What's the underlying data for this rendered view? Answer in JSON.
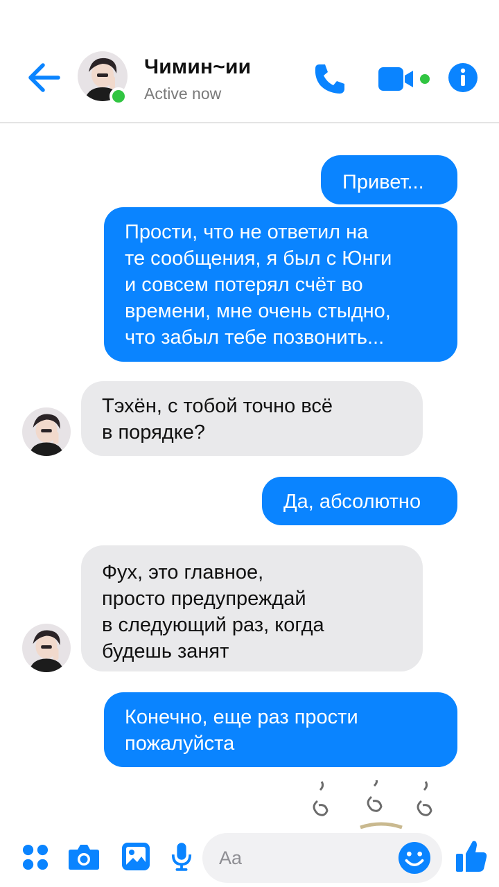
{
  "header": {
    "contact_name": "Чимин~ии",
    "status": "Active now",
    "accent_color": "#0a84ff",
    "online_color": "#31c542"
  },
  "messages": [
    {
      "direction": "outgoing",
      "text": "Привет..."
    },
    {
      "direction": "outgoing",
      "text": "Прости, что не ответил на\nте сообщения, я был с Юнги\nи совсем потерял счёт во\nвремени, мне очень стыдно,\nчто забыл тебе позвонить..."
    },
    {
      "direction": "incoming",
      "text": "Тэхён, с тобой точно всё\nв порядке?"
    },
    {
      "direction": "outgoing",
      "text": "Да, абсолютно"
    },
    {
      "direction": "incoming",
      "text": "Фух, это главное,\nпросто предупреждай\nв следующий раз, когда\nбудешь занят"
    },
    {
      "direction": "outgoing",
      "text": "Конечно, еще раз прости\nпожалуйста"
    }
  ],
  "composer": {
    "placeholder": "Aa"
  },
  "icons": {
    "back": "arrow-left-icon",
    "call": "phone-icon",
    "video": "video-camera-icon",
    "info": "info-icon",
    "apps": "apps-grid-icon",
    "camera": "camera-icon",
    "gallery": "image-icon",
    "mic": "microphone-icon",
    "emoji": "emoji-icon",
    "like": "thumbs-up-icon"
  }
}
